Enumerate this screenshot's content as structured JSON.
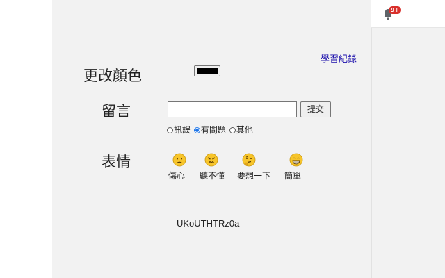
{
  "header": {
    "notification_badge": "9+",
    "bell_icon": "bell-icon"
  },
  "links": {
    "learning_record": "學習紀錄"
  },
  "form": {
    "change_color_label": "更改顏色",
    "color_value": "#000000",
    "message_label": "留言",
    "message_value": "",
    "submit_label": "提交",
    "radio_options": [
      {
        "label": "訊誤",
        "checked": false
      },
      {
        "label": "有問題",
        "checked": true
      },
      {
        "label": "其他",
        "checked": false
      }
    ],
    "emotion_label": "表情",
    "emotions": [
      {
        "label": "傷心",
        "icon": "sad-face-icon"
      },
      {
        "label": "聽不懂",
        "icon": "confused-face-icon"
      },
      {
        "label": "要想一下",
        "icon": "thinking-face-icon"
      },
      {
        "label": "簡單",
        "icon": "grin-face-icon"
      }
    ],
    "captcha_text": "UKoUTHTRz0a"
  },
  "colors": {
    "panel_bg": "#f2f2f2",
    "link": "#1a0dab",
    "badge": "#d9302b",
    "emoji_yellow": "#f7c52b"
  }
}
